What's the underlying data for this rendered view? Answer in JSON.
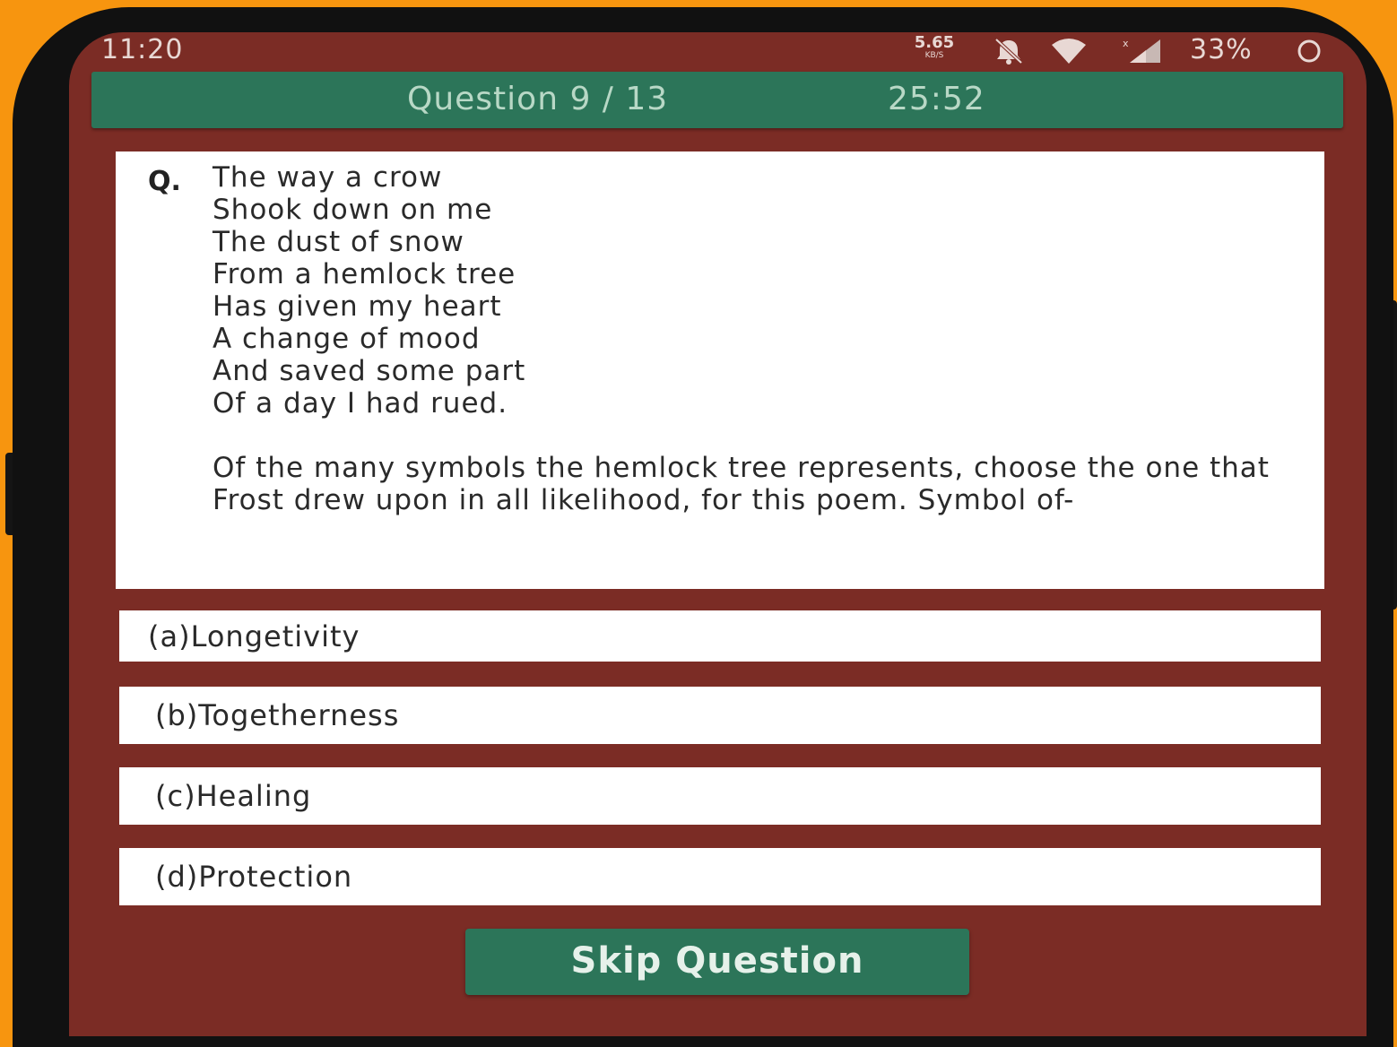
{
  "status_bar": {
    "time": "11:20",
    "net_speed_value": "5.65",
    "net_speed_unit": "KB/S",
    "battery": "33%",
    "icons": [
      "bell-off-icon",
      "wifi-icon",
      "signal-icon",
      "battery-icon"
    ]
  },
  "header": {
    "question_counter": "Question 9 / 13",
    "timer": "25:52"
  },
  "question": {
    "prefix": "Q.",
    "poem_lines": [
      "The way a crow",
      "Shook down on me",
      "The dust of snow",
      "From a hemlock tree",
      "Has given my heart",
      "A change of mood",
      "And saved some part",
      "Of a day I had rued."
    ],
    "body": "Of the many symbols the hemlock tree represents, choose the one that Frost drew upon in all likelihood, for this poem. Symbol of-"
  },
  "options": [
    {
      "label": "(a)Longetivity"
    },
    {
      "label": "(b)Togetherness"
    },
    {
      "label": "(c)Healing"
    },
    {
      "label": "(d)Protection"
    }
  ],
  "skip_button": {
    "label": "Skip Question"
  },
  "colors": {
    "background": "#f7950f",
    "screen": "#7b2c25",
    "accent": "#2c7559",
    "card": "#ffffff"
  }
}
